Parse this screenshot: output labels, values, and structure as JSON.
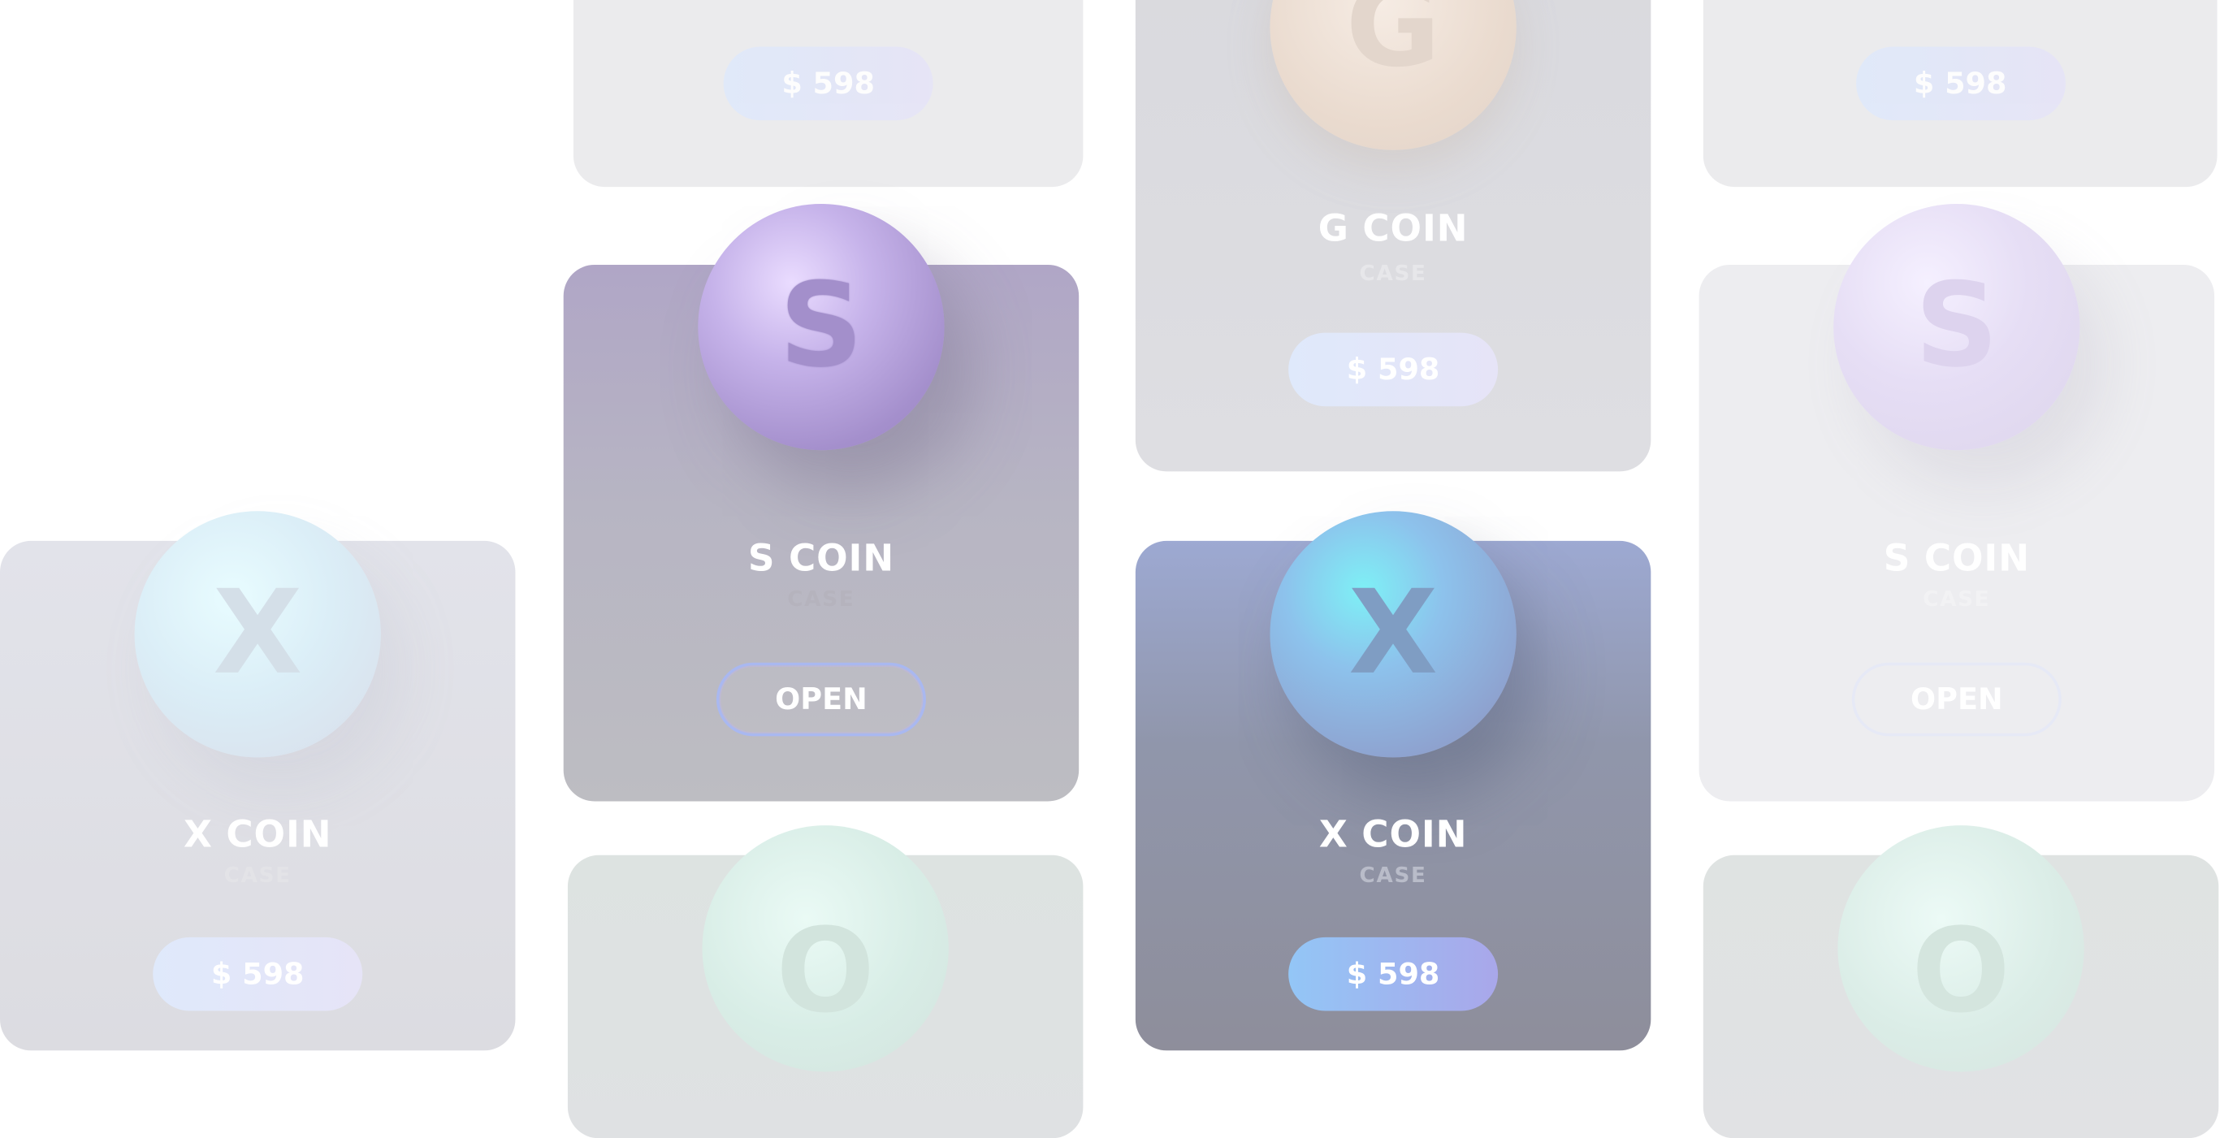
{
  "cards": {
    "c1": {
      "price": "$ 598"
    },
    "c2": {
      "coin": "G",
      "title": "G COIN",
      "sub": "CASE",
      "price": "$ 598"
    },
    "c3": {
      "price": "$ 598"
    },
    "c4": {
      "coin": "S",
      "title": "S COIN",
      "sub": "CASE",
      "button": "OPEN"
    },
    "c5": {
      "coin": "S",
      "title": "S COIN",
      "sub": "CASE",
      "button": "OPEN"
    },
    "c6": {
      "coin": "X",
      "title": "X COIN",
      "sub": "CASE",
      "price": "$ 598"
    },
    "c7": {
      "coin": "X",
      "title": "X COIN",
      "sub": "CASE",
      "price": "$ 598"
    },
    "c8": {
      "coin": "O"
    },
    "c9": {
      "coin": "O"
    }
  },
  "colors": {
    "accent_blue": "#93c6f6",
    "accent_purple": "#a98fd6",
    "card_default": "#e8e8ec"
  }
}
